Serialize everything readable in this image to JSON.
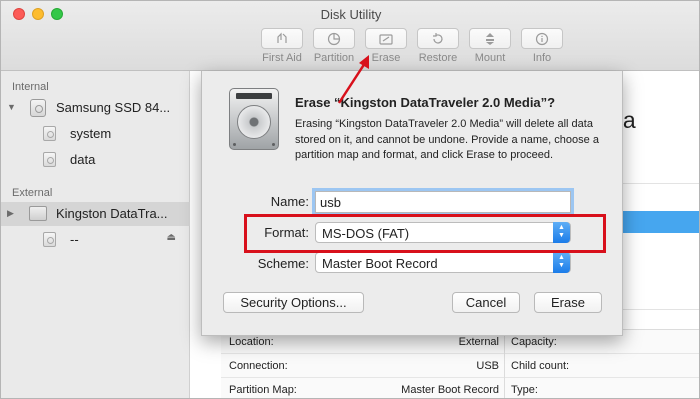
{
  "window": {
    "title": "Disk Utility"
  },
  "toolbar": {
    "items": [
      {
        "label": "First Aid",
        "icon": "first-aid-icon"
      },
      {
        "label": "Partition",
        "icon": "partition-icon"
      },
      {
        "label": "Erase",
        "icon": "erase-icon"
      },
      {
        "label": "Restore",
        "icon": "restore-icon"
      },
      {
        "label": "Mount",
        "icon": "mount-icon"
      },
      {
        "label": "Info",
        "icon": "info-icon"
      }
    ]
  },
  "sidebar": {
    "internal_label": "Internal",
    "external_label": "External",
    "items": [
      {
        "label": "Samsung SSD 84..."
      },
      {
        "label": "system"
      },
      {
        "label": "data"
      },
      {
        "label": "Kingston DataTra..."
      },
      {
        "label": "--"
      }
    ]
  },
  "main": {
    "heading_fragment": "dia",
    "info": [
      {
        "key": "Location:",
        "value": "External",
        "key2": "Capacity:"
      },
      {
        "key": "Connection:",
        "value": "USB",
        "key2": "Child count:"
      },
      {
        "key": "Partition Map:",
        "value": "Master Boot Record",
        "key2": "Type:"
      }
    ]
  },
  "dialog": {
    "title": "Erase “Kingston DataTraveler 2.0 Media”?",
    "message": "Erasing “Kingston DataTraveler 2.0 Media” will delete all data stored on it, and cannot be undone. Provide a name, choose a partition map and format, and click Erase to proceed.",
    "name_label": "Name:",
    "name_value": "usb",
    "format_label": "Format:",
    "format_value": "MS-DOS (FAT)",
    "scheme_label": "Scheme:",
    "scheme_value": "Master Boot Record",
    "security_button": "Security Options...",
    "cancel_button": "Cancel",
    "erase_button": "Erase"
  },
  "colors": {
    "annotation_red": "#d8101b",
    "accent_blue": "#1b7ce9"
  }
}
